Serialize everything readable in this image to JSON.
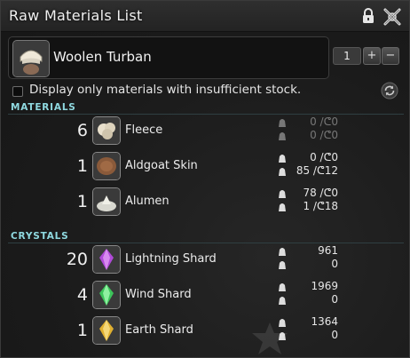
{
  "window": {
    "title": "Raw Materials List"
  },
  "recipe": {
    "item_name": "Woolen Turban",
    "quantity": "1",
    "plus_label": "+",
    "minus_label": "−"
  },
  "filter": {
    "label": "Display only materials with insufficient stock."
  },
  "sections": {
    "materials": "MATERIALS",
    "crystals": "CRYSTALS"
  },
  "materials": [
    {
      "qty": "6",
      "name": "Fleece",
      "icon": "fleece-icon",
      "inv": "0 /",
      "inv_hq": "0",
      "retainer": "0 /",
      "retainer_hq": "0",
      "dim": true
    },
    {
      "qty": "1",
      "name": "Aldgoat Skin",
      "icon": "aldgoat-skin-icon",
      "inv": "0 /",
      "inv_hq": "0",
      "retainer": "85 /",
      "retainer_hq": "12",
      "dim": false
    },
    {
      "qty": "1",
      "name": "Alumen",
      "icon": "alumen-icon",
      "inv": "78 /",
      "inv_hq": "0",
      "retainer": "1 /",
      "retainer_hq": "18",
      "dim": false
    }
  ],
  "crystals": [
    {
      "qty": "20",
      "name": "Lightning Shard",
      "icon": "lightning-shard-icon",
      "inv": "961",
      "retainer": "0"
    },
    {
      "qty": "4",
      "name": "Wind Shard",
      "icon": "wind-shard-icon",
      "inv": "1969",
      "retainer": "0"
    },
    {
      "qty": "1",
      "name": "Earth Shard",
      "icon": "earth-shard-icon",
      "inv": "1364",
      "retainer": "0"
    }
  ],
  "colors": {
    "section_header": "#8fd9e0",
    "lightning_shard": "#b04ad8",
    "wind_shard": "#3cc45a",
    "earth_shard": "#e0b030"
  }
}
